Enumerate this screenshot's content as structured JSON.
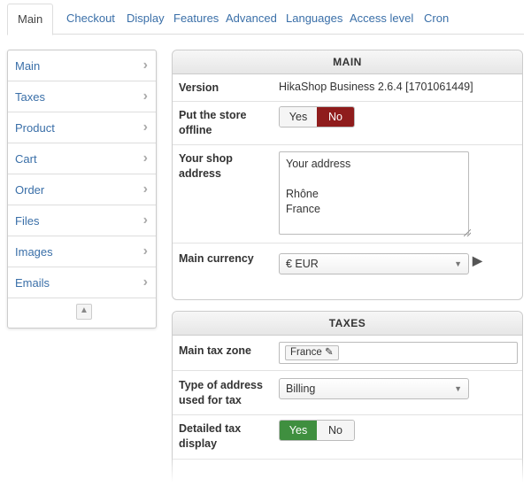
{
  "tabs": [
    {
      "label": "Main"
    },
    {
      "label": "Checkout"
    },
    {
      "label": "Display"
    },
    {
      "label": "Features"
    },
    {
      "label": "Advanced"
    },
    {
      "label": "Languages"
    },
    {
      "label": "Access level"
    },
    {
      "label": "Cron"
    }
  ],
  "sidebar": {
    "items": [
      {
        "label": "Main"
      },
      {
        "label": "Taxes"
      },
      {
        "label": "Product"
      },
      {
        "label": "Cart"
      },
      {
        "label": "Order"
      },
      {
        "label": "Files"
      },
      {
        "label": "Images"
      },
      {
        "label": "Emails"
      }
    ],
    "chevron": "›"
  },
  "main_panel": {
    "title": "MAIN",
    "version_label": "Version",
    "version_value": "HikaShop Business 2.6.4 [1701061449]",
    "offline_label": "Put the store offline",
    "offline_yes": "Yes",
    "offline_no": "No",
    "address_label": "Your shop address",
    "address_value": "Your address\n\nRhône\nFrance",
    "currency_label": "Main currency",
    "currency_value": "€ EUR"
  },
  "taxes_panel": {
    "title": "TAXES",
    "zone_label": "Main tax zone",
    "zone_tag": "France ✎",
    "address_type_label": "Type of address used for tax",
    "address_type_value": "Billing",
    "detailed_label": "Detailed tax display",
    "detailed_yes": "Yes",
    "detailed_no": "No"
  },
  "colors": {
    "link": "#3a6fa8",
    "toggle_no_active": "#8f1c1c",
    "toggle_yes_active": "#3f8f3f"
  },
  "icons": {
    "scroll_top": "scroll-to-top-icon",
    "currency_arrow": "chevron-right-icon",
    "select_caret": "chevron-down-icon",
    "tag_edit": "pencil-icon"
  }
}
